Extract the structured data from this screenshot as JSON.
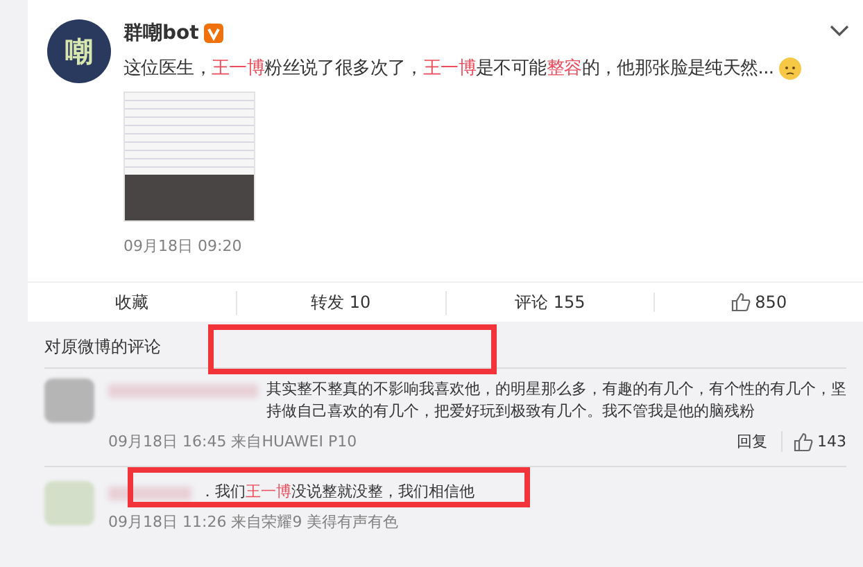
{
  "post": {
    "author": "群嘲bot",
    "avatar_text": "嘲",
    "verified": true,
    "text": [
      {
        "text": "这位医生，",
        "highlight": false
      },
      {
        "text": "王一博",
        "highlight": true
      },
      {
        "text": "粉丝说了很多次了，",
        "highlight": false
      },
      {
        "text": "王一博",
        "highlight": true
      },
      {
        "text": "是不可能",
        "highlight": false
      },
      {
        "text": "整容",
        "highlight": true
      },
      {
        "text": "的，他那张脸是纯天然...",
        "highlight": false
      }
    ],
    "time": "09月18日 09:20"
  },
  "actions": [
    {
      "kind": "text",
      "label": "收藏"
    },
    {
      "kind": "text",
      "label": "转发 10"
    },
    {
      "kind": "text",
      "label": "评论 155"
    },
    {
      "kind": "like",
      "label": "850"
    }
  ],
  "comments_header": "对原微博的评论",
  "comments": [
    {
      "text": [
        {
          "text": "其实整不整真的不影响我喜欢他，的明星那么多，有趣的有几个，有个性的有几个，坚持做自己喜欢的有几个，把爱好玩到极致有几个。我不管我是他的脑残粉",
          "highlight": false
        }
      ],
      "meta": "09月18日 16:45 来自HUAWEI P10",
      "reply": "回复",
      "likes": "143"
    },
    {
      "text": [
        {
          "text": "．我们",
          "highlight": false
        },
        {
          "text": "王一博",
          "highlight": true
        },
        {
          "text": "没说整就没整，我们相信他",
          "highlight": false
        }
      ],
      "meta": "09月18日 11:26 来自荣耀9 美得有声有色"
    }
  ]
}
